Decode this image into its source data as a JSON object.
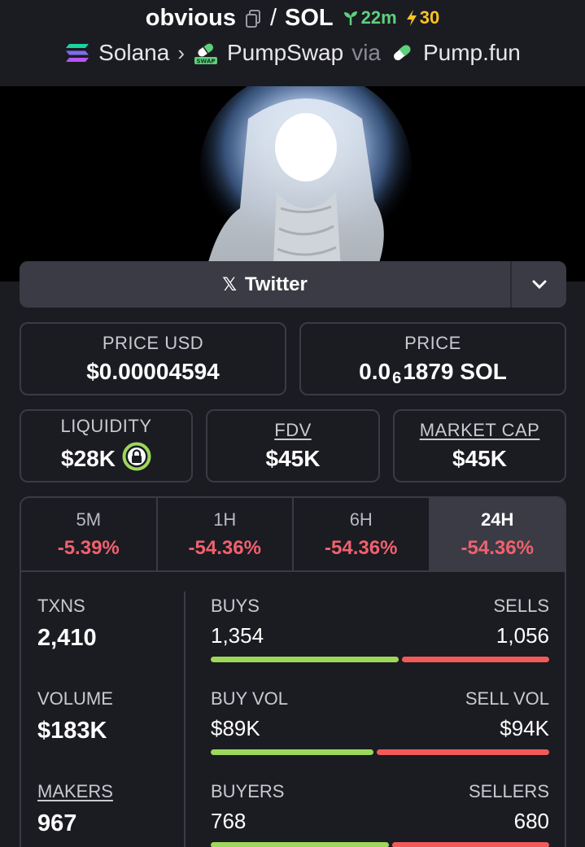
{
  "header": {
    "token": "obvious",
    "separator": "/",
    "quote": "SOL",
    "age": "22m",
    "boosts": "30",
    "chain": "Solana",
    "dex": "PumpSwap",
    "via": "via",
    "launchpad": "Pump.fun",
    "dex_badge": "SWAP"
  },
  "social": {
    "twitter_label": "Twitter",
    "x_glyph": "𝕏"
  },
  "price": {
    "usd_label": "PRICE USD",
    "usd_value": "$0.00004594",
    "native_label": "PRICE",
    "native_prefix": "0.0",
    "native_zeros": "6",
    "native_suffix": "1879 SOL"
  },
  "metrics": {
    "liquidity_label": "LIQUIDITY",
    "liquidity_value": "$28K",
    "fdv_label": "FDV",
    "fdv_value": "$45K",
    "mcap_label": "MARKET CAP",
    "mcap_value": "$45K"
  },
  "timeframes": [
    {
      "label": "5M",
      "change": "-5.39%"
    },
    {
      "label": "1H",
      "change": "-54.36%"
    },
    {
      "label": "6H",
      "change": "-54.36%"
    },
    {
      "label": "24H",
      "change": "-54.36%",
      "active": true
    }
  ],
  "txns": {
    "label": "TXNS",
    "value": "2,410",
    "buys_label": "BUYS",
    "buys": "1,354",
    "sells_label": "SELLS",
    "sells": "1,056"
  },
  "volume": {
    "label": "VOLUME",
    "value": "$183K",
    "buy_label": "BUY VOL",
    "buy": "$89K",
    "sell_label": "SELL VOL",
    "sell": "$94K"
  },
  "makers": {
    "label": "MAKERS",
    "value": "967",
    "buyers_label": "BUYERS",
    "buyers": "768",
    "sellers_label": "SELLERS",
    "sellers": "680"
  },
  "colors": {
    "positive": "#9dd85a",
    "negative": "#f25a5a",
    "age": "#5fd07c",
    "boost": "#f7c325"
  }
}
